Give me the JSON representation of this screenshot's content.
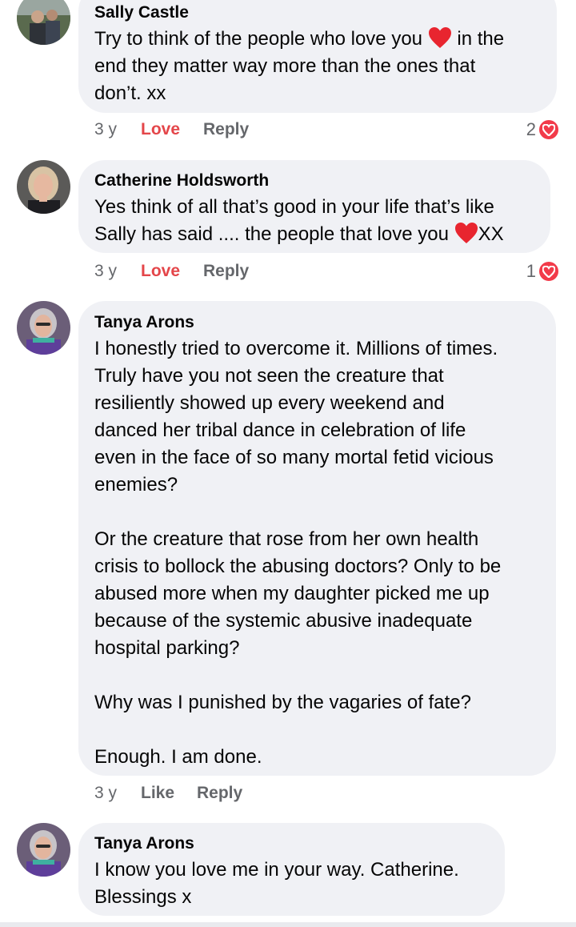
{
  "comments": [
    {
      "author": "Sally Castle",
      "lines": [
        [
          "Try to think of the people who love you ",
          "heart",
          " in the"
        ],
        [
          "end they matter way more than the ones that"
        ],
        [
          "don’t. xx"
        ]
      ],
      "time": "3 y",
      "action": "Love",
      "reply": "Reply",
      "reaction_count": "2"
    },
    {
      "author": "Catherine Holdsworth",
      "lines": [
        [
          "Yes think of all that’s good in your life that’s like"
        ],
        [
          "Sally has said .... the people that love you ",
          "heart",
          "XX"
        ]
      ],
      "time": "3 y",
      "action": "Love",
      "reply": "Reply",
      "reaction_count": "1"
    },
    {
      "author": "Tanya Arons",
      "lines": [
        [
          "I honestly tried to overcome it.  Millions of times."
        ],
        [
          "Truly have you not seen the creature that"
        ],
        [
          "resiliently showed up every weekend and"
        ],
        [
          "danced her tribal dance in celebration of life"
        ],
        [
          "even in the face of so many mortal fetid vicious"
        ],
        [
          "enemies?"
        ],
        [
          ""
        ],
        [
          "Or the creature that rose from her own health"
        ],
        [
          "crisis to bollock the abusing doctors? Only to be"
        ],
        [
          "abused more when my daughter picked me up"
        ],
        [
          "because of the systemic abusive inadequate"
        ],
        [
          "hospital parking?"
        ],
        [
          ""
        ],
        [
          "Why was I punished by the vagaries of fate?"
        ],
        [
          ""
        ],
        [
          "Enough.  I am done."
        ]
      ],
      "time": "3 y",
      "action": "Like",
      "reply": "Reply"
    },
    {
      "author": "Tanya Arons",
      "lines": [
        [
          "I know you love me in your way.  Catherine."
        ],
        [
          "Blessings x"
        ]
      ]
    }
  ],
  "colors": {
    "bubble": "#f0f1f5",
    "love": "#e4464a",
    "meta": "#65676b",
    "heart": "#e8252f",
    "reaction": "#f23b4a"
  },
  "icons": {
    "heart": "red-heart-icon",
    "reaction": "love-reaction-icon"
  }
}
